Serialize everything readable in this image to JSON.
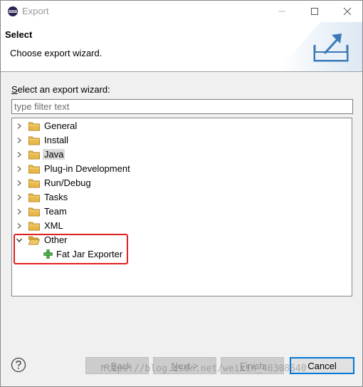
{
  "window": {
    "title": "Export"
  },
  "banner": {
    "title": "Select",
    "description": "Choose export wizard."
  },
  "filter": {
    "label_accel": "S",
    "label_rest": "elect an export wizard:",
    "placeholder": "type filter text",
    "value": ""
  },
  "tree": {
    "items": [
      {
        "label": "General",
        "expanded": false
      },
      {
        "label": "Install",
        "expanded": false
      },
      {
        "label": "Java",
        "expanded": false,
        "selected": true
      },
      {
        "label": "Plug-in Development",
        "expanded": false
      },
      {
        "label": "Run/Debug",
        "expanded": false
      },
      {
        "label": "Tasks",
        "expanded": false
      },
      {
        "label": "Team",
        "expanded": false
      },
      {
        "label": "XML",
        "expanded": false
      },
      {
        "label": "Other",
        "expanded": true
      }
    ],
    "child": {
      "parent": "Other",
      "label": "Fat Jar Exporter"
    }
  },
  "buttons": {
    "back": {
      "prefix": "< ",
      "accel": "B",
      "rest": "ack",
      "enabled": false
    },
    "next": {
      "accel": "N",
      "rest": "ext >",
      "enabled": false
    },
    "finish": {
      "accel": "F",
      "rest": "inish",
      "enabled": false
    },
    "cancel": {
      "label": "Cancel",
      "enabled": true
    }
  },
  "watermark": "https://blog.csdn.net/weixin_40308640",
  "colors": {
    "folder": "#e8b84a",
    "highlight": "#e02020",
    "plus": "#4cae4c"
  }
}
